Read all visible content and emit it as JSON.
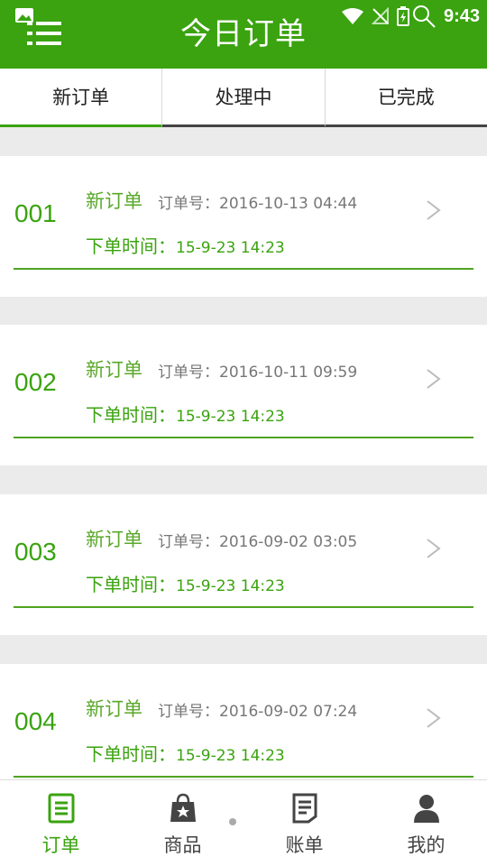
{
  "header": {
    "title": "今日订单",
    "time": "9:43"
  },
  "tabs": [
    {
      "label": "新订单",
      "active": true
    },
    {
      "label": "处理中",
      "active": false
    },
    {
      "label": "已完成",
      "active": false
    }
  ],
  "orders": [
    {
      "num": "001",
      "status": "新订单",
      "order_no": "订单号：2016-10-13 04:44",
      "time_label": "下单时间：",
      "time_value": "15-9-23  14:23"
    },
    {
      "num": "002",
      "status": "新订单",
      "order_no": "订单号：2016-10-11 09:59",
      "time_label": "下单时间：",
      "time_value": "15-9-23  14:23"
    },
    {
      "num": "003",
      "status": "新订单",
      "order_no": "订单号：2016-09-02 03:05",
      "time_label": "下单时间：",
      "time_value": "15-9-23  14:23"
    },
    {
      "num": "004",
      "status": "新订单",
      "order_no": "订单号：2016-09-02 07:24",
      "time_label": "下单时间：",
      "time_value": "15-9-23  14:23"
    }
  ],
  "nav": [
    {
      "label": "订单",
      "icon": "orders-icon",
      "active": true
    },
    {
      "label": "商品",
      "icon": "goods-bag-icon",
      "active": false
    },
    {
      "label": "账单",
      "icon": "bill-icon",
      "active": false
    },
    {
      "label": "我的",
      "icon": "profile-icon",
      "active": false
    }
  ],
  "colors": {
    "brand": "#3aa30f",
    "order_text": "#777777",
    "background": "#ebebeb"
  }
}
